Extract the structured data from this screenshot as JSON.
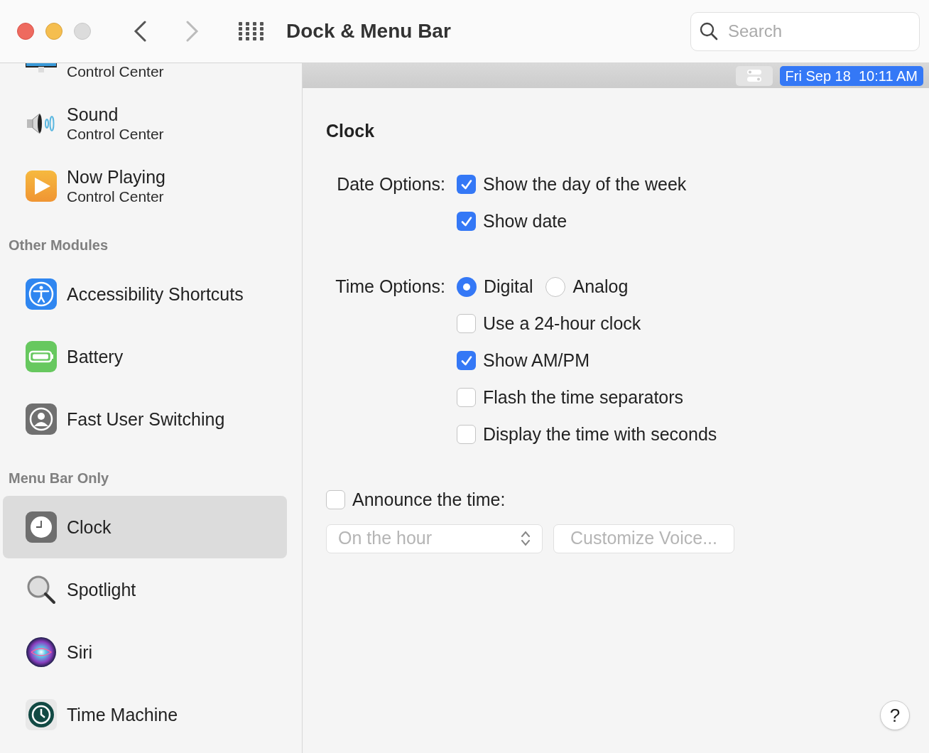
{
  "toolbar": {
    "title": "Dock & Menu Bar",
    "search": {
      "placeholder": "Search"
    }
  },
  "sidebar": {
    "items": [
      {
        "kind": "module",
        "subtitle": "Control Center",
        "selected": false
      },
      {
        "kind": "module",
        "title": "Sound",
        "subtitle": "Control Center",
        "selected": false
      },
      {
        "kind": "module",
        "title": "Now Playing",
        "subtitle": "Control Center",
        "selected": false
      },
      {
        "kind": "heading",
        "title": "Other Modules"
      },
      {
        "kind": "module",
        "title": "Accessibility Shortcuts",
        "selected": false
      },
      {
        "kind": "module",
        "title": "Battery",
        "selected": false
      },
      {
        "kind": "module",
        "title": "Fast User Switching",
        "selected": false
      },
      {
        "kind": "heading",
        "title": "Menu Bar Only"
      },
      {
        "kind": "module",
        "title": "Clock",
        "selected": true
      },
      {
        "kind": "module",
        "title": "Spotlight",
        "selected": false
      },
      {
        "kind": "module",
        "title": "Siri",
        "selected": false
      },
      {
        "kind": "module",
        "title": "Time Machine",
        "selected": false
      }
    ]
  },
  "menu_bar_preview": {
    "clock_text": "Fri Sep 18  10:11 AM"
  },
  "panel": {
    "heading": "Clock",
    "date_options": {
      "label": "Date Options:",
      "checkboxes": [
        {
          "label": "Show the day of the week",
          "checked": true
        },
        {
          "label": "Show date",
          "checked": true
        }
      ]
    },
    "time_options": {
      "label": "Time Options:",
      "radios": [
        {
          "label": "Digital",
          "selected": true
        },
        {
          "label": "Analog",
          "selected": false
        }
      ],
      "checkboxes": [
        {
          "label": "Use a 24-hour clock",
          "checked": false
        },
        {
          "label": "Show AM/PM",
          "checked": true
        },
        {
          "label": "Flash the time separators",
          "checked": false
        },
        {
          "label": "Display the time with seconds",
          "checked": false
        }
      ]
    },
    "announce": {
      "label": "Announce the time:",
      "checked": false,
      "interval": {
        "value": "On the hour",
        "disabled": true
      },
      "customize_button": {
        "label": "Customize Voice...",
        "disabled": true
      }
    }
  },
  "help_button": {
    "label": "?"
  }
}
